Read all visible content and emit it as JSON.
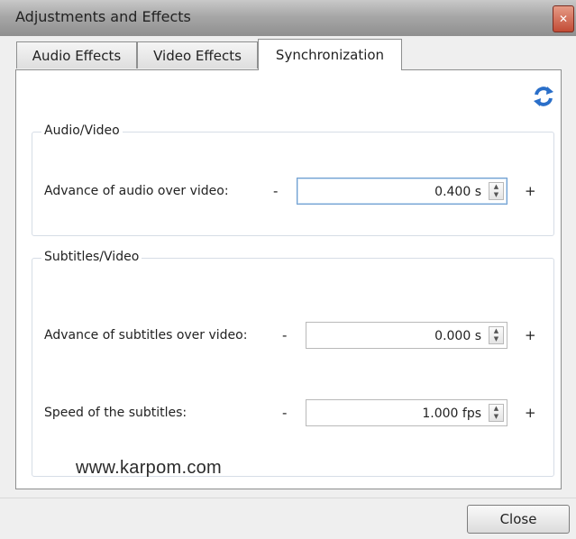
{
  "window": {
    "title": "Adjustments and Effects",
    "close_glyph": "✕"
  },
  "tabs": [
    {
      "label": "Audio Effects",
      "active": false
    },
    {
      "label": "Video Effects",
      "active": false
    },
    {
      "label": "Synchronization",
      "active": true
    }
  ],
  "audio_video": {
    "title": "Audio/Video",
    "advance_label": "Advance of audio over video:",
    "minus": "-",
    "value": "0.400 s",
    "plus": "+"
  },
  "subtitles_video": {
    "title": "Subtitles/Video",
    "advance_label": "Advance of subtitles over video:",
    "advance_minus": "-",
    "advance_value": "0.000 s",
    "advance_plus": "+",
    "speed_label": "Speed of the subtitles:",
    "speed_minus": "-",
    "speed_value": "1.000 fps",
    "speed_plus": "+"
  },
  "spin": {
    "up": "▲",
    "down": "▼"
  },
  "watermark": "www.karpom.com",
  "footer": {
    "close_label": "Close"
  },
  "icons": {
    "sync": "sync-refresh-icon"
  },
  "colors": {
    "sync_icon": "#2a6fc9",
    "title_close": "#c24b35"
  }
}
